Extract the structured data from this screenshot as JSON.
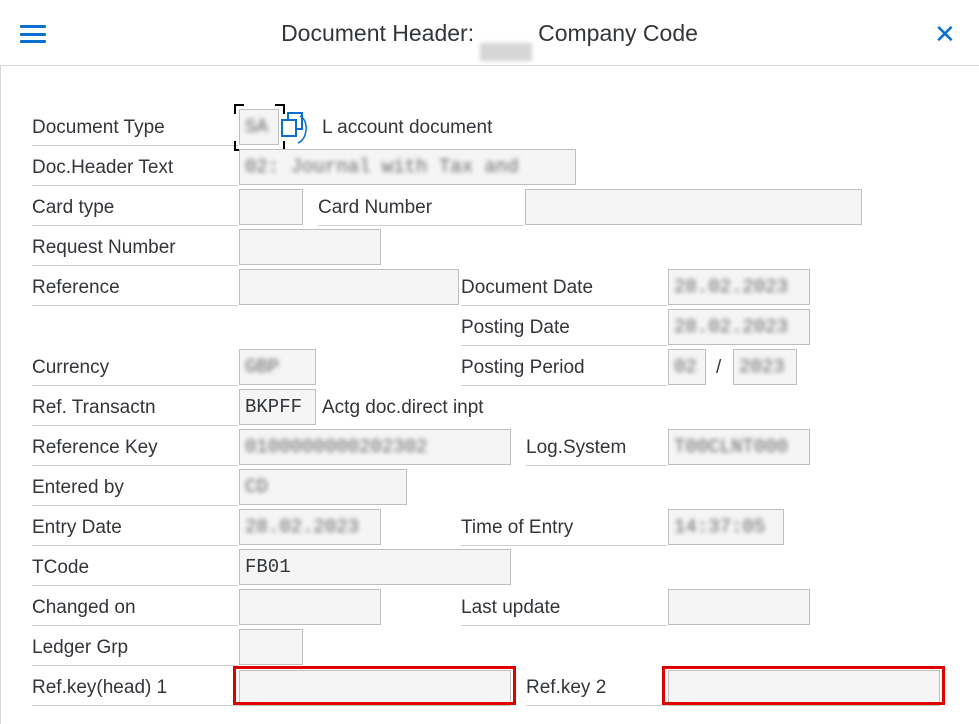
{
  "header": {
    "title_prefix": "Document Header:",
    "title_company": "1000",
    "title_suffix": "Company Code"
  },
  "rows": {
    "doc_type": {
      "label": "Document Type",
      "value": "SA",
      "desc": "L account document"
    },
    "doc_header_text": {
      "label": "Doc.Header Text",
      "value": "02: Journal with Tax and"
    },
    "card_type": {
      "label": "Card type",
      "value": ""
    },
    "card_number": {
      "label": "Card Number",
      "value": ""
    },
    "request_number": {
      "label": "Request Number",
      "value": ""
    },
    "reference": {
      "label": "Reference",
      "value": ""
    },
    "document_date": {
      "label": "Document Date",
      "value": "28.02.2023"
    },
    "posting_date": {
      "label": "Posting Date",
      "value": "28.02.2023"
    },
    "currency": {
      "label": "Currency",
      "value": "GBP"
    },
    "posting_period": {
      "label": "Posting Period",
      "period": "02",
      "separator": "/",
      "year": "2023"
    },
    "ref_transactn": {
      "label": "Ref. Transactn",
      "value": "BKPFF",
      "desc": "Actg doc.direct inpt"
    },
    "reference_key": {
      "label": "Reference Key",
      "value": "0100000000202302"
    },
    "log_system": {
      "label": "Log.System",
      "value": "T00CLNT000"
    },
    "entered_by": {
      "label": "Entered by",
      "value": "CD"
    },
    "entry_date": {
      "label": "Entry Date",
      "value": "28.02.2023"
    },
    "time_of_entry": {
      "label": "Time of Entry",
      "value": "14:37:05"
    },
    "tcode": {
      "label": "TCode",
      "value": "FB01"
    },
    "changed_on": {
      "label": "Changed on",
      "value": ""
    },
    "last_update": {
      "label": "Last update",
      "value": ""
    },
    "ledger_grp": {
      "label": "Ledger Grp",
      "value": ""
    },
    "ref_key_head_1": {
      "label": "Ref.key(head) 1",
      "value": ""
    },
    "ref_key_2": {
      "label": "Ref.key 2",
      "value": ""
    }
  },
  "colors": {
    "accent": "#0a6ed1",
    "highlight": "#e00000"
  }
}
